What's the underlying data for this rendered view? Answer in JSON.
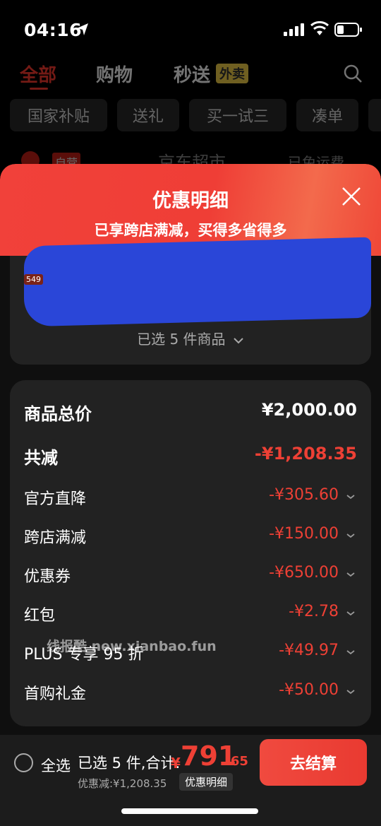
{
  "status": {
    "time": "04:16"
  },
  "top_nav": {
    "tabs": [
      "全部",
      "购物",
      "秒送"
    ],
    "waimai_tag": "外卖"
  },
  "chips": [
    "国家补贴",
    "送礼",
    "买一试三",
    "凑单"
  ],
  "store": {
    "tag": "自营",
    "name": "京东超市",
    "shipping": "已免运费"
  },
  "sheet": {
    "title": "优惠明细",
    "subtitle": "已享跨店满减，买得多省得多",
    "badge": "549",
    "selected_count": "已选 5 件商品"
  },
  "details": {
    "total": {
      "label": "商品总价",
      "value": "¥2,000.00"
    },
    "reduction": {
      "label": "共减",
      "value": "-¥1,208.35"
    },
    "items": [
      {
        "label": "官方直降",
        "value": "-¥305.60"
      },
      {
        "label": "跨店满减",
        "value": "-¥150.00"
      },
      {
        "label": "优惠券",
        "value": "-¥650.00"
      },
      {
        "label": "红包",
        "value": "-¥2.78"
      },
      {
        "label": "PLUS 专享 95 折",
        "value": "-¥49.97"
      },
      {
        "label": "首购礼金",
        "value": "-¥50.00"
      }
    ]
  },
  "watermark": "线报酷 new.xianbao.fun",
  "bottom": {
    "select_all": "全选",
    "selected_text": "已选 5 件,合计:",
    "currency": "¥",
    "price_int": "791",
    "price_dec": ".65",
    "discount_text": "优惠减:¥1,208.35",
    "detail_pill": "优惠明细",
    "checkout": "去结算"
  },
  "colors": {
    "accent": "#ee4035",
    "header_red": "#f1413a",
    "card_bg": "#222222"
  }
}
